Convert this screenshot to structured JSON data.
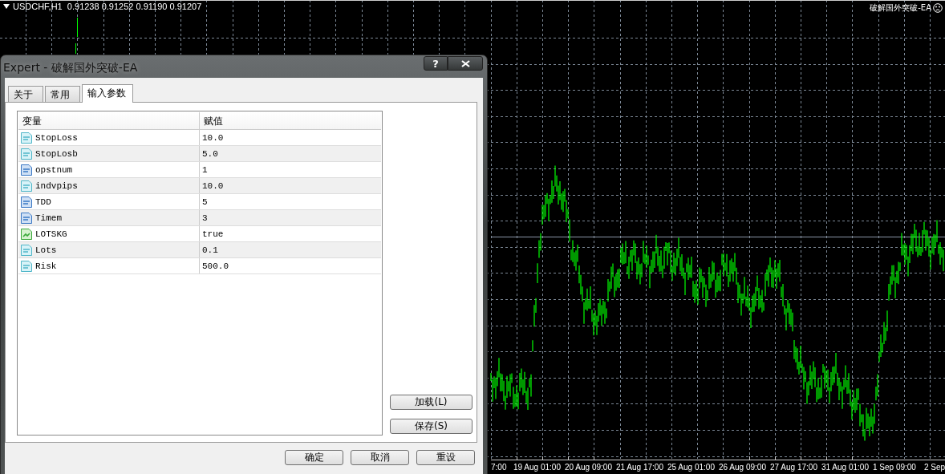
{
  "chart": {
    "title": "USDCHF,H1  0.91238 0.91252 0.91190 0.91207",
    "expert_label": "破解国外突破-EA",
    "x_labels": [
      "7:00",
      "19 Aug 01:00",
      "20 Aug 09:00",
      "21 Aug 17:00",
      "25 Aug 01:00",
      "26 Aug 09:00",
      "27 Aug 17:00",
      "31 Aug 01:00",
      "1 Sep 09:00",
      "2 Sep"
    ]
  },
  "dialog": {
    "title": "Expert - 破解国外突破-EA",
    "help_button": "?",
    "tabs": [
      {
        "label": "关于",
        "selected": false
      },
      {
        "label": "常用",
        "selected": false
      },
      {
        "label": "输入参数",
        "selected": true
      }
    ],
    "table": {
      "columns": [
        "变量",
        "赋值"
      ],
      "rows": [
        {
          "kind": "double",
          "name": "StopLoss",
          "value": "10.0"
        },
        {
          "kind": "double",
          "name": "StopLosb",
          "value": "5.0"
        },
        {
          "kind": "int",
          "name": "opstnum",
          "value": "1"
        },
        {
          "kind": "double",
          "name": "indvpips",
          "value": "10.0"
        },
        {
          "kind": "int",
          "name": "TDD",
          "value": "5"
        },
        {
          "kind": "int",
          "name": "Timem",
          "value": "3"
        },
        {
          "kind": "bool",
          "name": "LOTSKG",
          "value": "true"
        },
        {
          "kind": "double",
          "name": "Lots",
          "value": "0.1"
        },
        {
          "kind": "double",
          "name": "Risk",
          "value": "500.0"
        }
      ]
    },
    "side_buttons": [
      "加载(L)",
      "保存(S)"
    ],
    "buttons": [
      "确定",
      "取消",
      "重设"
    ]
  }
}
